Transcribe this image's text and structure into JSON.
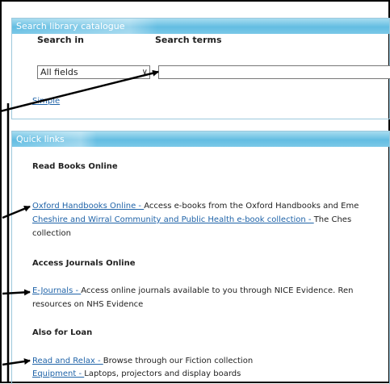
{
  "search": {
    "header": "Search library catalogue",
    "search_in_label": "Search in",
    "search_terms_label": "Search terms",
    "field_value": "All fields",
    "terms_value": "",
    "simple_link": "Simple"
  },
  "quick_links": {
    "header": "Quick links",
    "sections": [
      {
        "title": "Read Books Online",
        "items": [
          {
            "link": "Oxford Handbooks Online - ",
            "text": "Access e-books from the Oxford Handbooks and Eme"
          },
          {
            "link": "Cheshire and Wirral Community and Public Health e-book collection - ",
            "text": "The Ches",
            "cont": "collection"
          }
        ]
      },
      {
        "title": "Access Journals Online",
        "items": [
          {
            "link": "E-Journals - ",
            "text": "Access online journals available to you through NICE Evidence. Ren",
            "cont": "resources on NHS Evidence"
          }
        ]
      },
      {
        "title": "Also for Loan",
        "items": [
          {
            "link": "Read and Relax - ",
            "text": "Browse through our Fiction collection"
          },
          {
            "link": "Equipment - ",
            "text": "Laptops, projectors and display boards"
          }
        ]
      }
    ]
  },
  "colors": {
    "bar": "#63bde2",
    "link": "#1f63a8",
    "border": "#9cc8dc"
  }
}
